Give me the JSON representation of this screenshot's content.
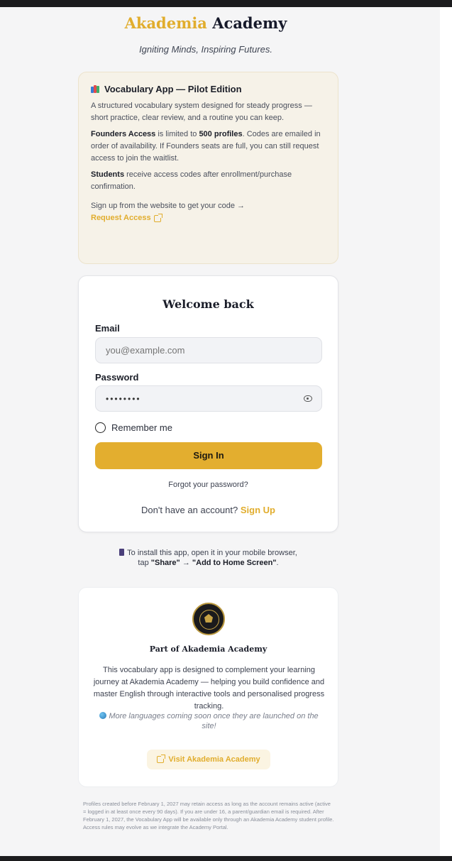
{
  "header": {
    "brand_primary": "Akademia",
    "brand_secondary": "Academy",
    "tagline": "Igniting Minds, Inspiring Futures."
  },
  "info_card": {
    "title": "Vocabulary App — Pilot Edition",
    "title_icon": "books-icon",
    "intro": "A structured vocabulary system designed for steady progress — short practice, clear review, and a routine you can keep.",
    "founders_bold": "Founders Access",
    "founders_text_1": " is limited to ",
    "founders_limit": "500 profiles",
    "founders_text_2": ". Codes are emailed in order of availability. If Founders seats are full, you can still request access to join the waitlist.",
    "students_bold": "Students",
    "students_text": " receive access codes after enrollment/purchase confirmation.",
    "signup_hint": "Sign up from the website to get your code →",
    "request_link": "Request Access"
  },
  "login": {
    "heading": "Welcome back",
    "email_label": "Email",
    "email_placeholder": "you@example.com",
    "password_label": "Password",
    "password_value": "••••••••",
    "remember_label": "Remember me",
    "signin_label": "Sign In",
    "forgot_label": "Forgot your password?",
    "no_account_text": "Don't have an account?",
    "signup_label": "Sign Up"
  },
  "install": {
    "line1": "To install this app, open it in your mobile browser,",
    "line2_pre": "tap ",
    "share": "\"Share\"",
    "arrow": " → ",
    "add_home": "\"Add to Home Screen\"",
    "line2_post": "."
  },
  "about": {
    "title": "Part of Akademia Academy",
    "description": "This vocabulary app is designed to complement your learning journey at Akademia Academy — helping you build confidence and master English through interactive tools and personalised progress tracking.",
    "coming_soon": "More languages coming soon once they are launched on the site!",
    "visit_label": "Visit Akademia Academy"
  },
  "disclaimer": "Profiles created before February 1, 2027 may retain access as long as the account remains active (active = logged in at least once every 90 days). If you are under 16, a parent/guardian email is required. After February 1, 2027, the Vocabulary App will be available only through an Akademia Academy student profile. Access rules may evolve as we integrate the Academy Portal.",
  "colors": {
    "accent": "#e1ad2d",
    "button": "#e3ae2f",
    "info_bg": "#f6f2e8",
    "page_bg": "#f5f5f6"
  }
}
